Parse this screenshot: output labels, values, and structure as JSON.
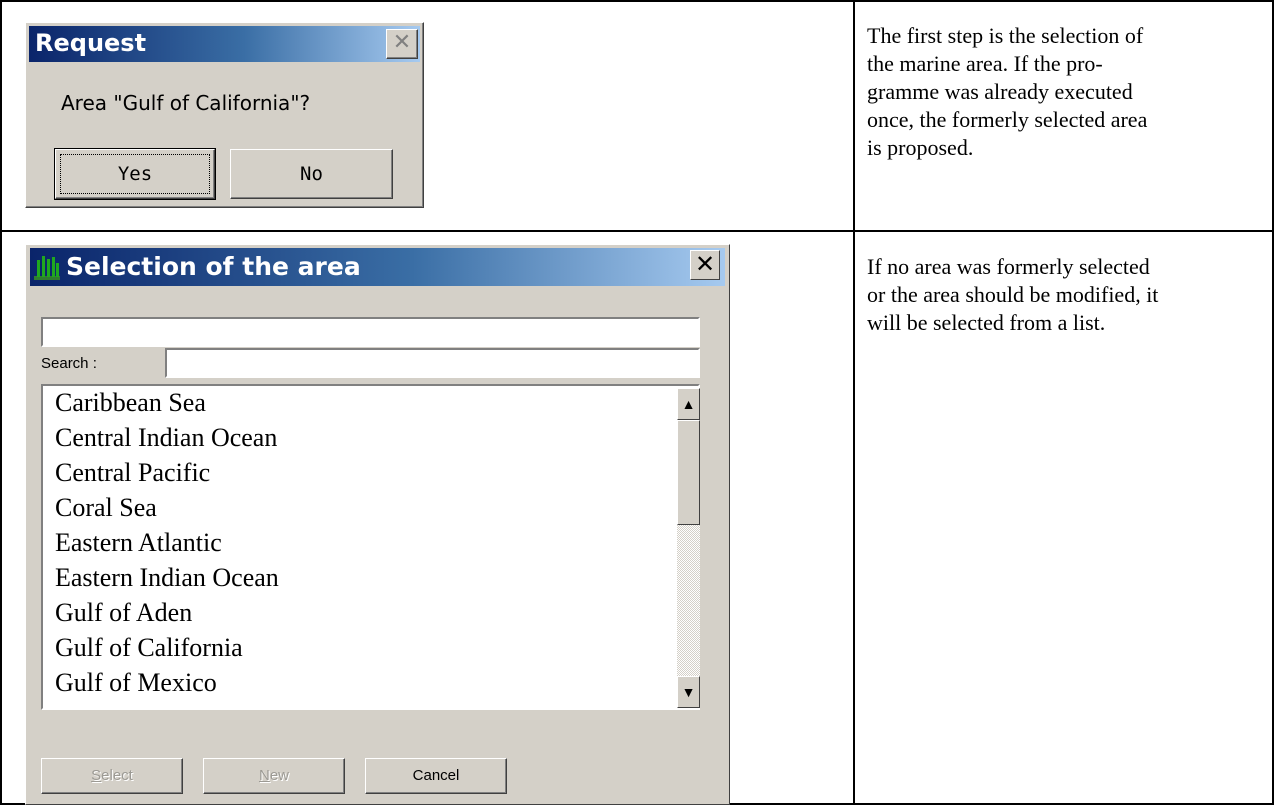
{
  "request_dialog": {
    "title": "Request",
    "message": "Area \"Gulf of California\"?",
    "yes_label": "Yes",
    "no_label": "No",
    "close_glyph": "✕"
  },
  "descriptions": {
    "row1": "The first step is the selection of\nthe marine area. If the pro-\ngramme was already executed\nonce, the formerly selected area\nis proposed.",
    "row2": "If no area was formerly selected\nor the area should be modified, it\nwill be selected from a list."
  },
  "selection_dialog": {
    "title": "Selection of the area",
    "close_glyph": "✕",
    "selected_value": "",
    "search_label": "Search :",
    "search_value": "",
    "items": [
      "Caribbean Sea",
      "Central Indian Ocean",
      "Central Pacific",
      "Coral Sea",
      "Eastern Atlantic",
      "Eastern Indian Ocean",
      "Gulf of Aden",
      "Gulf of California",
      "Gulf of Mexico"
    ],
    "select_label_first": "S",
    "select_label_rest": "elect",
    "new_label_first": "N",
    "new_label_rest": "ew",
    "cancel_label": "Cancel",
    "scroll_up_glyph": "▲",
    "scroll_down_glyph": "▼"
  },
  "colors": {
    "titlebar_start": "#0a246a",
    "titlebar_end": "#a6caf0",
    "dialog_face": "#d4d0c8"
  },
  "icons": {
    "app": "forest-icon",
    "close": "close-icon"
  }
}
